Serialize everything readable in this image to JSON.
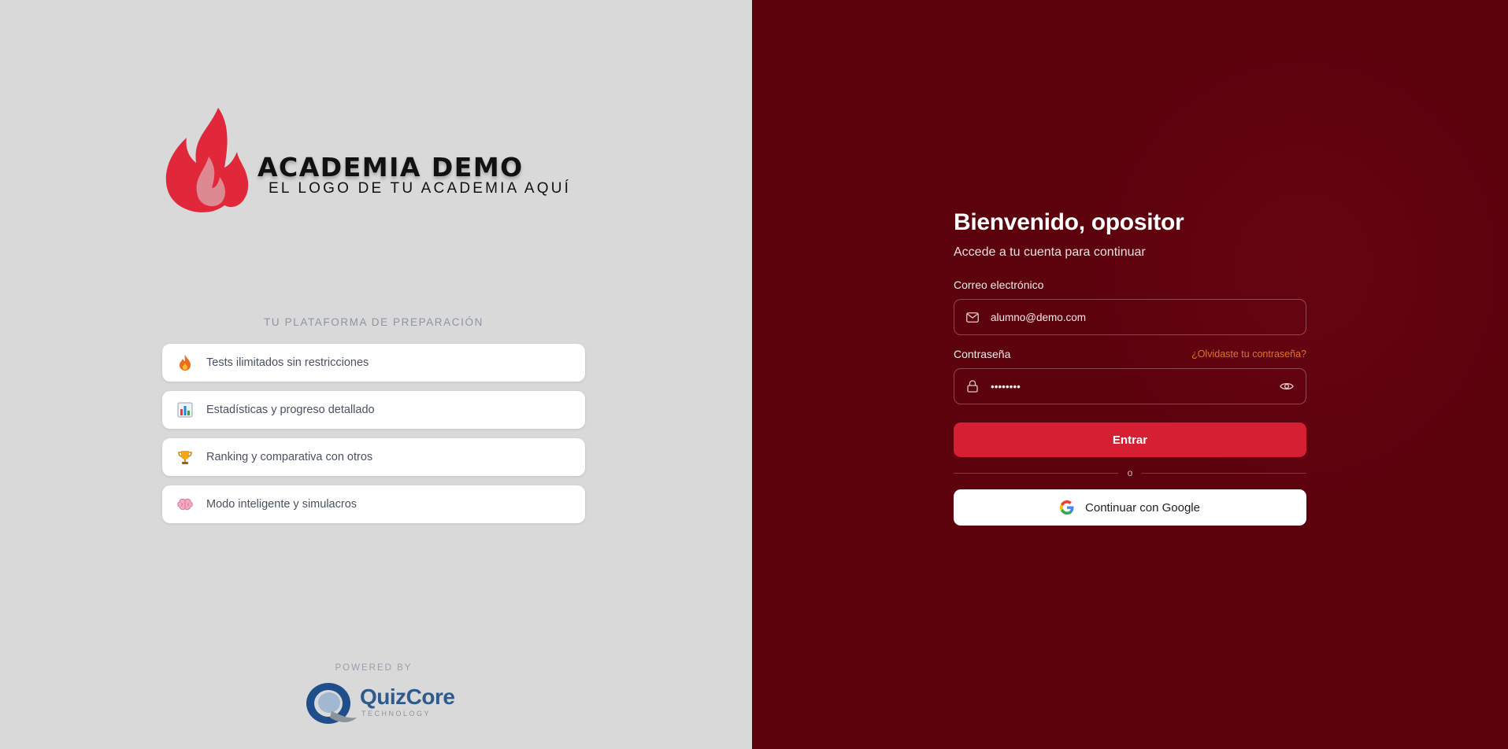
{
  "brand": {
    "name": "ACADEMIA DEMO",
    "tagline": "EL LOGO DE TU ACADEMIA AQUÍ"
  },
  "platform": {
    "title": "TU PLATAFORMA DE PREPARACIÓN",
    "features": [
      {
        "icon": "fire-icon",
        "label": "Tests ilimitados sin restricciones"
      },
      {
        "icon": "bar-chart-icon",
        "label": "Estadísticas y progreso detallado"
      },
      {
        "icon": "trophy-icon",
        "label": "Ranking y comparativa con otros"
      },
      {
        "icon": "brain-icon",
        "label": "Modo inteligente y simulacros"
      }
    ]
  },
  "powered_by": {
    "label": "POWERED BY",
    "logo_word": "QuizCore",
    "logo_sub": "TECHNOLOGY"
  },
  "login": {
    "title": "Bienvenido, opositor",
    "subtitle": "Accede a tu cuenta para continuar",
    "email_label": "Correo electrónico",
    "email_value": "alumno@demo.com",
    "password_label": "Contraseña",
    "password_value": "••••••••",
    "forgot_link": "¿Olvidaste tu contraseña?",
    "submit_label": "Entrar",
    "divider_text": "o",
    "google_label": "Continuar con Google"
  },
  "colors": {
    "left_bg": "#d9d9d9",
    "right_bg": "#5c020d",
    "primary_button": "#d71f33",
    "link": "#e2741a"
  }
}
